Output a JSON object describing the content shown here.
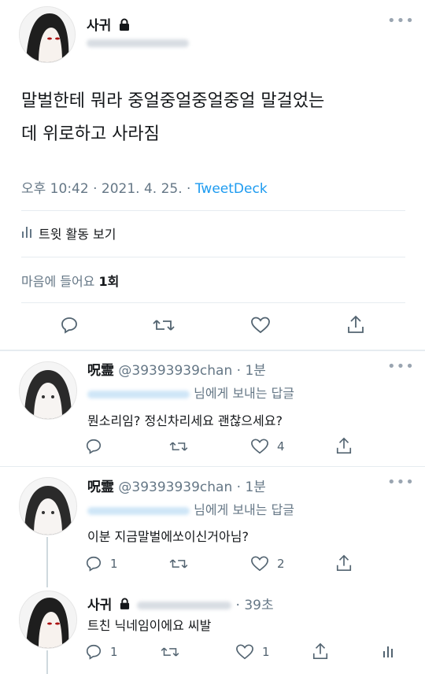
{
  "main_tweet": {
    "author_name": "사귀",
    "text_line1": "말벌한테 뭐라 중얼중얼중얼중얼 말걸었는",
    "text_line2": "데 위로하고 사라짐",
    "time": "오후 10:42",
    "date": "2021. 4. 25.",
    "source": "TweetDeck",
    "activity_label": "트윗 활동 보기",
    "likes_label": "마음에 들어요",
    "likes_count": "1회"
  },
  "replies": [
    {
      "author_name": "呪霊",
      "handle": "@39393939chan",
      "time": "1분",
      "reply_to_suffix": "님에게 보내는 답글",
      "text": "뭔소리임? 정신차리세요 괜찮으세요?",
      "like_count": "4"
    },
    {
      "author_name": "呪霊",
      "handle": "@39393939chan",
      "time": "1분",
      "reply_to_suffix": "님에게 보내는 답글",
      "text": "이분 지금말벌에쏘이신거아님?",
      "reply_count": "1",
      "like_count": "2"
    },
    {
      "author_name": "사귀",
      "time": "39초",
      "text": "트친 닉네임이에요 씨발",
      "reply_count": "1",
      "like_count": "1"
    }
  ],
  "sep": "·",
  "icons": [
    "more-icon",
    "lock-icon",
    "reply-icon",
    "retweet-icon",
    "like-icon",
    "share-icon",
    "analytics-icon"
  ],
  "colors": {
    "link": "#1d9bf0",
    "secondary": "#657786",
    "divider": "#e6ecf0"
  }
}
